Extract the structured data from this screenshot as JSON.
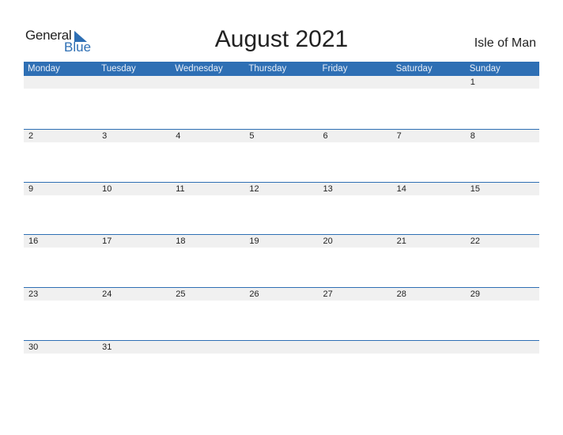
{
  "logo": {
    "general": "General",
    "blue": "Blue",
    "icon": "triangle-flag-icon"
  },
  "title": "August 2021",
  "country": "Isle of Man",
  "colors": {
    "accent": "#2e6fb4",
    "day_bar": "#f0f0f0"
  },
  "weekdays": [
    "Monday",
    "Tuesday",
    "Wednesday",
    "Thursday",
    "Friday",
    "Saturday",
    "Sunday"
  ],
  "weeks": [
    [
      "",
      "",
      "",
      "",
      "",
      "",
      "1"
    ],
    [
      "2",
      "3",
      "4",
      "5",
      "6",
      "7",
      "8"
    ],
    [
      "9",
      "10",
      "11",
      "12",
      "13",
      "14",
      "15"
    ],
    [
      "16",
      "17",
      "18",
      "19",
      "20",
      "21",
      "22"
    ],
    [
      "23",
      "24",
      "25",
      "26",
      "27",
      "28",
      "29"
    ],
    [
      "30",
      "31",
      "",
      "",
      "",
      "",
      ""
    ]
  ]
}
